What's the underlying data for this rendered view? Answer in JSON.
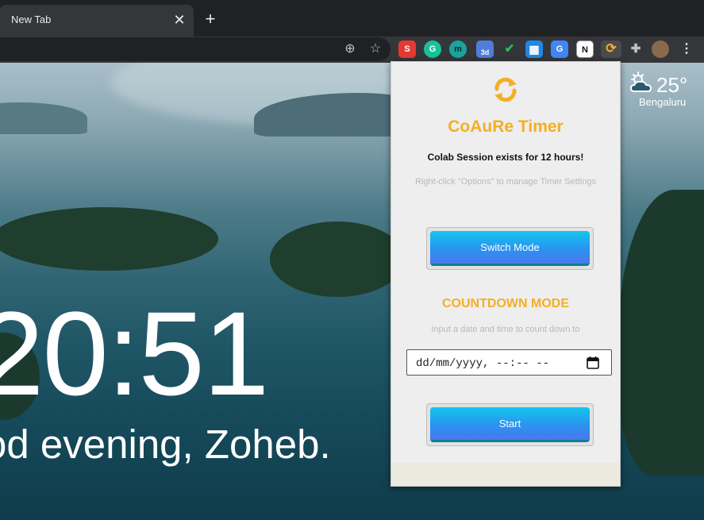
{
  "browser": {
    "tab_title": "New Tab",
    "tab_close": "✕",
    "new_tab": "+"
  },
  "toolbar": {
    "location_icon": "⊕",
    "bookmark_icon": "☆",
    "extensions": [
      {
        "name": "s-extension-icon",
        "label": "S",
        "color": "#e53935"
      },
      {
        "name": "grammarly-icon",
        "label": "G",
        "color": "#15c39a"
      },
      {
        "name": "m-extension-icon",
        "label": "m",
        "color": "#1aa39c"
      },
      {
        "name": "3d-extension-icon",
        "label": "3d",
        "color": "#4f7ddb"
      },
      {
        "name": "shield-extension-icon",
        "label": "✔",
        "color": "#2ebc4f"
      },
      {
        "name": "trello-extension-icon",
        "label": "▦",
        "color": "#1e88e5"
      },
      {
        "name": "translate-extension-icon",
        "label": "G",
        "color": "#4285f4"
      },
      {
        "name": "notion-extension-icon",
        "label": "N",
        "color": "#ffffff"
      },
      {
        "name": "coaure-timer-extension-icon",
        "label": "⟳",
        "color": "#f5ae24"
      },
      {
        "name": "puzzle-extensions-icon",
        "label": "✚",
        "color": "#c0c2c6"
      }
    ],
    "menu_icon": "⋮"
  },
  "page": {
    "clock": "20:51",
    "greeting": "od evening, Zoheb.",
    "weather_temp": "25°",
    "weather_city": "Bengaluru"
  },
  "popup": {
    "title": "CoAuRe Timer",
    "session_text": "Colab Session exists for 12 hours!",
    "hint": "Right-click \"Options\" to manage Timer Settings",
    "switch_mode_label": "Switch Mode",
    "mode_title": "COUNTDOWN MODE",
    "mode_hint": "Input a date and time to count down to",
    "date_placeholder": "dd/mm/yyyy, --:-- --",
    "start_label": "Start",
    "accent_color": "#f5ae24"
  }
}
